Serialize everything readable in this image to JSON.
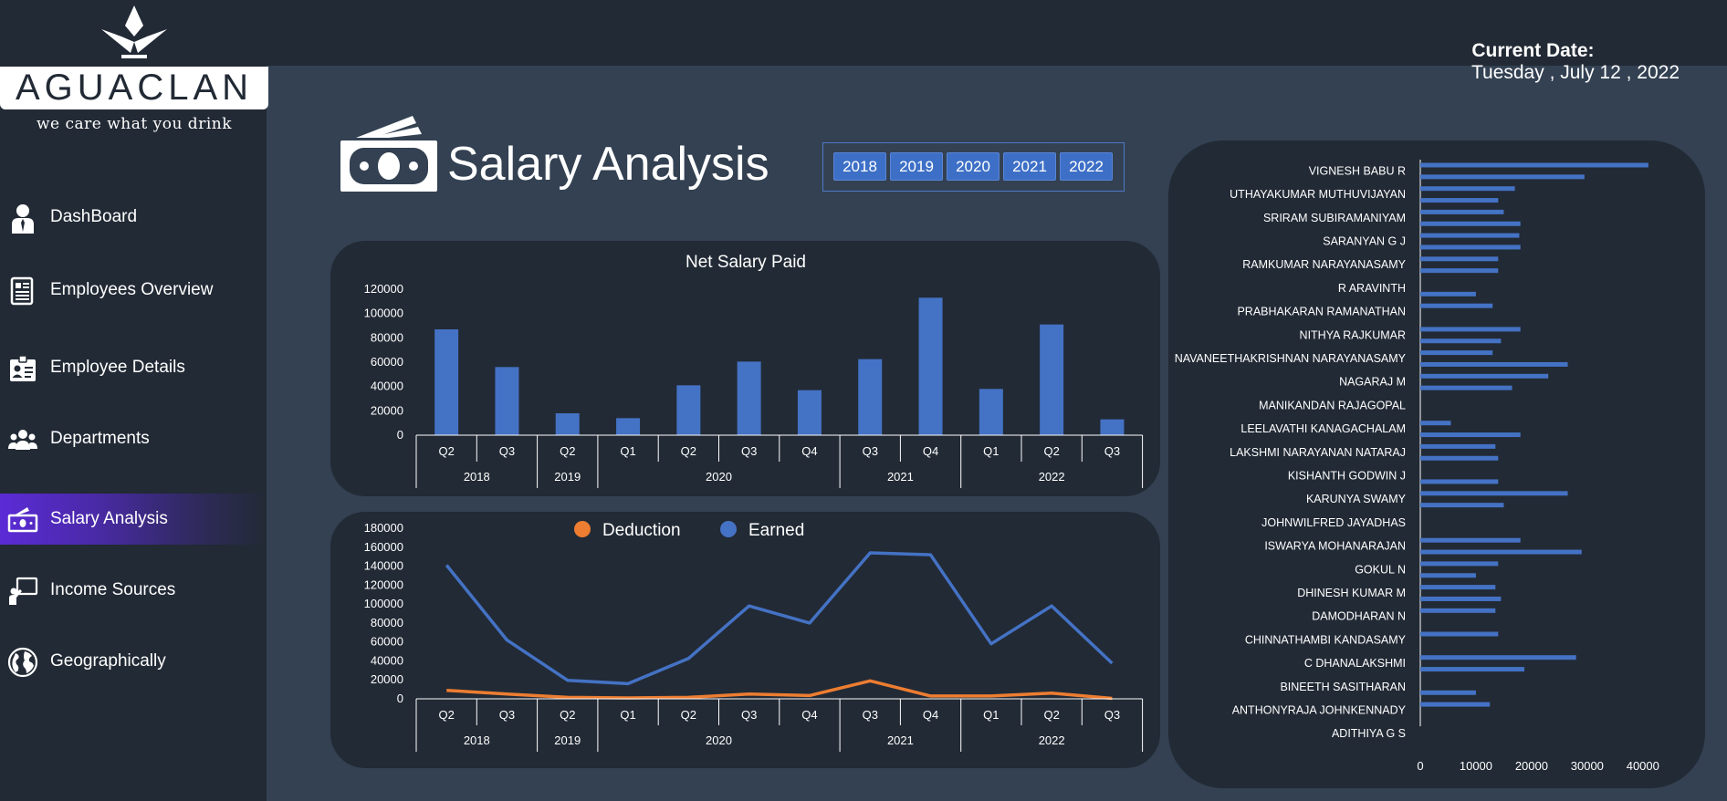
{
  "header": {
    "date_label": "Current Date:",
    "date_value": "Tuesday , July 12 , 2022"
  },
  "brand": {
    "name": "AGUACLAN",
    "tagline": "we care what you drink"
  },
  "sidebar": {
    "items": [
      {
        "label": "DashBoard",
        "icon": "user-tie-icon",
        "active": false
      },
      {
        "label": "Employees Overview",
        "icon": "newspaper-icon",
        "active": false
      },
      {
        "label": "Employee Details",
        "icon": "id-card-icon",
        "active": false
      },
      {
        "label": "Departments",
        "icon": "users-icon",
        "active": false
      },
      {
        "label": "Salary Analysis",
        "icon": "money-icon",
        "active": true
      },
      {
        "label": "Income Sources",
        "icon": "presenter-icon",
        "active": false
      },
      {
        "label": "Geographically",
        "icon": "globe-icon",
        "active": false
      }
    ]
  },
  "page": {
    "title": "Salary Analysis",
    "years": [
      "2018",
      "2019",
      "2020",
      "2021",
      "2022"
    ]
  },
  "colors": {
    "bar_blue": "#4472c4",
    "earned_blue": "#4472c4",
    "deduction_orange": "#ed7d31",
    "panel": "#222a35",
    "background": "#334152"
  },
  "chart_data": [
    {
      "type": "bar",
      "title": "Net Salary Paid",
      "categories": [
        "Q2",
        "Q3",
        "Q2",
        "Q1",
        "Q2",
        "Q3",
        "Q4",
        "Q3",
        "Q4",
        "Q1",
        "Q2",
        "Q3"
      ],
      "groups": [
        {
          "label": "2018",
          "span": 2
        },
        {
          "label": "2019",
          "span": 1
        },
        {
          "label": "2020",
          "span": 4
        },
        {
          "label": "2021",
          "span": 2
        },
        {
          "label": "2022",
          "span": 3
        }
      ],
      "values": [
        87000,
        56000,
        18000,
        14000,
        41000,
        60500,
        37000,
        62500,
        113000,
        38000,
        91000,
        13000
      ],
      "yticks": [
        "0",
        "20000",
        "40000",
        "60000",
        "80000",
        "100000",
        "120000"
      ],
      "ylim": [
        0,
        120000
      ],
      "legend": "none",
      "grid": false
    },
    {
      "type": "line",
      "categories": [
        "Q2",
        "Q3",
        "Q2",
        "Q1",
        "Q2",
        "Q3",
        "Q4",
        "Q3",
        "Q4",
        "Q1",
        "Q2",
        "Q3"
      ],
      "groups": [
        {
          "label": "2018",
          "span": 2
        },
        {
          "label": "2019",
          "span": 1
        },
        {
          "label": "2020",
          "span": 4
        },
        {
          "label": "2021",
          "span": 2
        },
        {
          "label": "2022",
          "span": 3
        }
      ],
      "series": [
        {
          "name": "Deduction",
          "color": "#ed7d31",
          "values": [
            9000,
            5000,
            1500,
            1000,
            1500,
            5000,
            3500,
            19000,
            3000,
            3000,
            6000,
            500
          ]
        },
        {
          "name": "Earned",
          "color": "#4472c4",
          "values": [
            141000,
            62000,
            19500,
            16000,
            42500,
            98000,
            80000,
            154000,
            152000,
            58000,
            98000,
            37500
          ]
        }
      ],
      "yticks": [
        "0",
        "20000",
        "40000",
        "60000",
        "80000",
        "100000",
        "120000",
        "140000",
        "160000",
        "180000"
      ],
      "ylim": [
        0,
        180000
      ],
      "legend": "top",
      "grid": false
    },
    {
      "type": "bar",
      "orientation": "horizontal",
      "labeled_rows": [
        "VIGNESH BABU R",
        "UTHAYAKUMAR MUTHUVIJAYAN",
        "SRIRAM SUBIRAMANIYAM",
        "SARANYAN G J",
        "RAMKUMAR NARAYANASAMY",
        "R ARAVINTH",
        "PRABHAKARAN RAMANATHAN",
        "NITHYA RAJKUMAR",
        "NAVANEETHAKRISHNAN NARAYANASAMY",
        "NAGARAJ M",
        "MANIKANDAN RAJAGOPAL",
        "LEELAVATHI KANAGACHALAM",
        "LAKSHMI NARAYANAN NATARAJ",
        "KISHANTH GODWIN J",
        "KARUNYA SWAMY",
        "JOHNWILFRED JAYADHAS",
        "ISWARYA MOHANARAJAN",
        "GOKUL N",
        "DHINESH KUMAR M",
        "DAMODHARAN N",
        "CHINNATHAMBI KANDASAMY",
        "C DHANALAKSHMI",
        "BINEETH SASITHARAN",
        "ANTHONYRAJA JOHNKENNADY",
        "ADITHIYA G S"
      ],
      "values": [
        41000,
        29500,
        17000,
        14000,
        15000,
        18000,
        17800,
        18000,
        14000,
        14000,
        0,
        10000,
        13000,
        0,
        18000,
        14500,
        13000,
        26500,
        23000,
        16500,
        0,
        0,
        5500,
        18000,
        13500,
        14000,
        0,
        14000,
        26500,
        15000,
        0,
        0,
        18000,
        29000,
        14000,
        10000,
        13500,
        14500,
        13500,
        0,
        14000,
        0,
        28000,
        18700,
        0,
        10000,
        12500,
        0
      ],
      "xticks": [
        "0",
        "10000",
        "20000",
        "30000",
        "40000"
      ],
      "xlim": [
        0,
        42000
      ],
      "legend": "none",
      "grid": false
    }
  ]
}
